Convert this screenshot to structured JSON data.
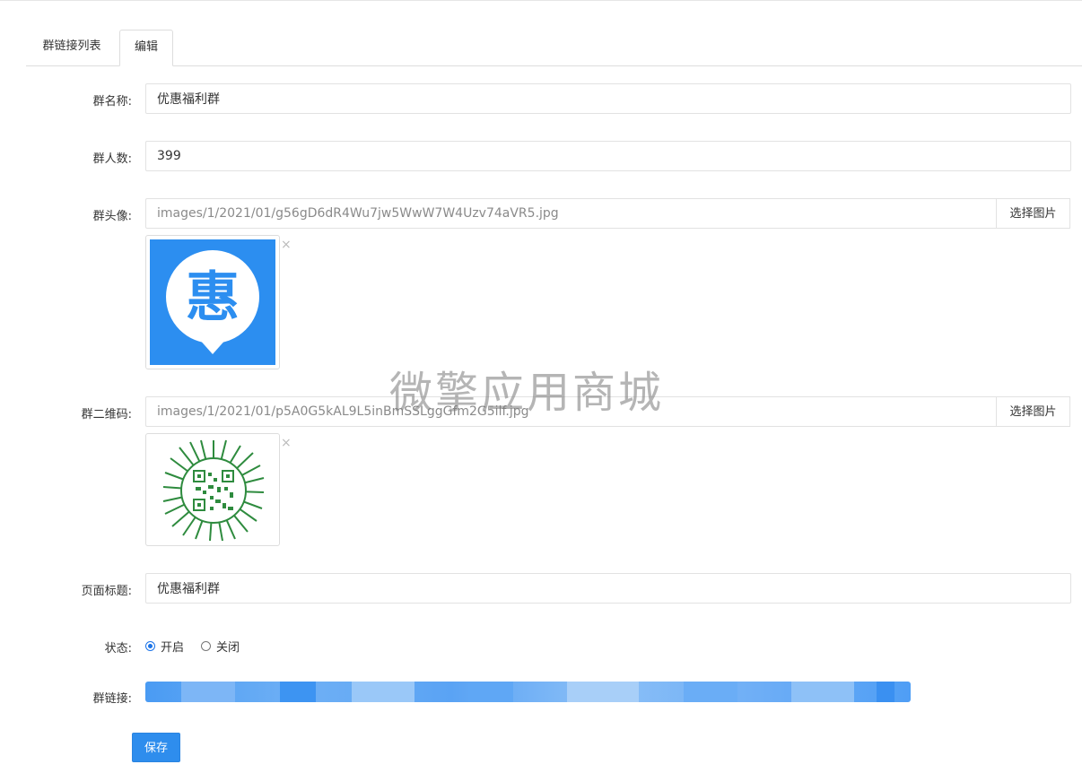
{
  "tabs": [
    {
      "label": "群链接列表",
      "active": false
    },
    {
      "label": "编辑",
      "active": true
    }
  ],
  "form": {
    "group_name": {
      "label": "群名称:",
      "value": "优惠福利群"
    },
    "member_count": {
      "label": "群人数:",
      "value": "399"
    },
    "avatar": {
      "label": "群头像:",
      "path": "images/1/2021/01/g56gD6dR4Wu7jw5WwW7W4Uzv74aVR5.jpg",
      "button": "选择图片",
      "remove": "×"
    },
    "qrcode": {
      "label": "群二维码:",
      "path": "images/1/2021/01/p5A0G5kAL9L5inBmSSLggGfm2G5ilf.jpg",
      "button": "选择图片",
      "remove": "×"
    },
    "page_title": {
      "label": "页面标题:",
      "value": "优惠福利群"
    },
    "status": {
      "label": "状态:",
      "options": [
        {
          "label": "开启",
          "checked": true
        },
        {
          "label": "关闭",
          "checked": false
        }
      ]
    },
    "link": {
      "label": "群链接:"
    }
  },
  "save_button": "保存",
  "watermark": "微擎应用商城",
  "avatar_glyph": "惠",
  "colors": {
    "accent": "#2e8ded",
    "avatar_bg": "#2c8ef0",
    "qr_green": "#2e8b3e"
  }
}
